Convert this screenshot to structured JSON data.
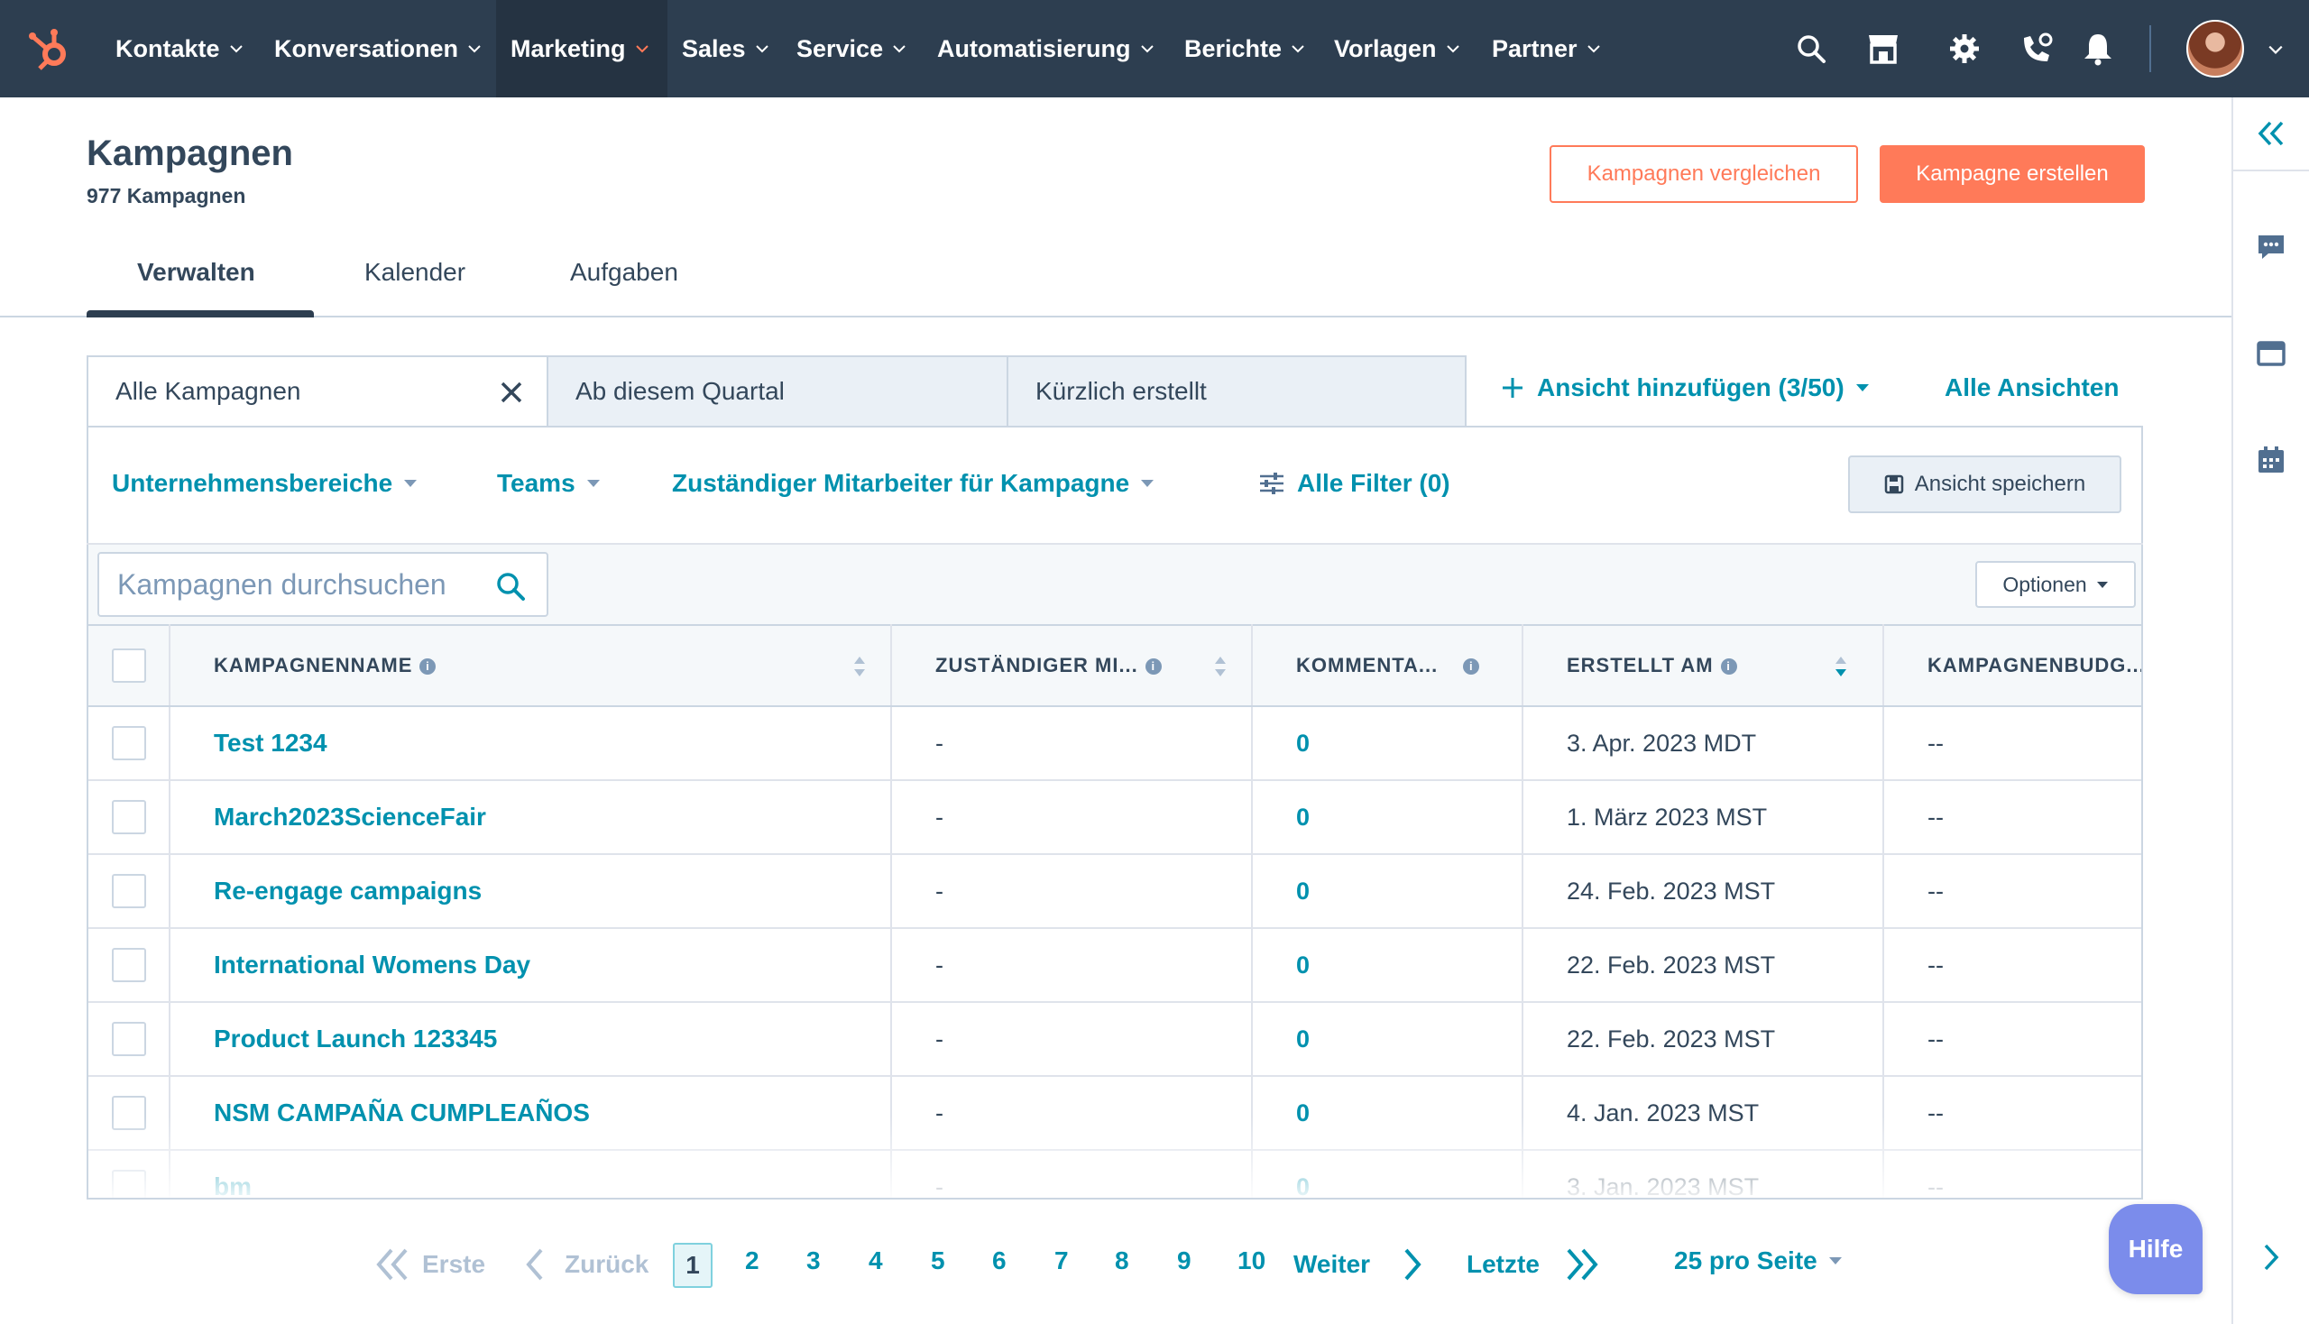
{
  "nav": {
    "items": [
      {
        "label": "Kontakte"
      },
      {
        "label": "Konversationen"
      },
      {
        "label": "Marketing"
      },
      {
        "label": "Sales"
      },
      {
        "label": "Service"
      },
      {
        "label": "Automatisierung"
      },
      {
        "label": "Berichte"
      },
      {
        "label": "Vorlagen"
      },
      {
        "label": "Partner"
      }
    ],
    "active": "Marketing",
    "icons": [
      "search-icon",
      "marketplace-icon",
      "settings-icon",
      "calling-icon",
      "notifications-icon"
    ]
  },
  "header": {
    "title": "Kampagnen",
    "subtitle": "977 Kampagnen",
    "compare_button": "Kampagnen vergleichen",
    "create_button": "Kampagne erstellen"
  },
  "tabs": [
    "Verwalten",
    "Kalender",
    "Aufgaben"
  ],
  "views": {
    "tabs": [
      "Alle Kampagnen",
      "Ab diesem Quartal",
      "Kürzlich erstellt"
    ],
    "add_view": "Ansicht hinzufügen (3/50)",
    "all_views": "Alle Ansichten"
  },
  "filters": {
    "business_units": "Unternehmensbereiche",
    "teams": "Teams",
    "owner": "Zuständiger Mitarbeiter für Kampagne",
    "all_filters": "Alle Filter (0)",
    "save_view": "Ansicht speichern"
  },
  "search": {
    "placeholder": "Kampagnen durchsuchen"
  },
  "options_button": "Optionen",
  "table": {
    "columns": [
      "KAMPAGNENNAME",
      "ZUSTÄNDIGER MI...",
      "KOMMENTA...",
      "ERSTELLT AM",
      "KAMPAGNENBUDG..."
    ],
    "rows": [
      {
        "name": "Test 1234",
        "owner": "-",
        "comments": "0",
        "created": "3. Apr. 2023 MDT",
        "budget": "--"
      },
      {
        "name": "March2023ScienceFair",
        "owner": "-",
        "comments": "0",
        "created": "1. März 2023 MST",
        "budget": "--"
      },
      {
        "name": "Re-engage campaigns",
        "owner": "-",
        "comments": "0",
        "created": "24. Feb. 2023 MST",
        "budget": "--"
      },
      {
        "name": "International Womens Day",
        "owner": "-",
        "comments": "0",
        "created": "22. Feb. 2023 MST",
        "budget": "--"
      },
      {
        "name": "Product Launch 123345",
        "owner": "-",
        "comments": "0",
        "created": "22. Feb. 2023 MST",
        "budget": "--"
      },
      {
        "name": "NSM CAMPAÑA CUMPLEAÑOS",
        "owner": "-",
        "comments": "0",
        "created": "4. Jan. 2023 MST",
        "budget": "--"
      },
      {
        "name": "bm",
        "owner": "-",
        "comments": "0",
        "created": "3. Jan. 2023 MST",
        "budget": "--"
      }
    ]
  },
  "pagination": {
    "first": "Erste",
    "prev": "Zurück",
    "current": "1",
    "pages": [
      "2",
      "3",
      "4",
      "5",
      "6",
      "7",
      "8",
      "9",
      "10"
    ],
    "next": "Weiter",
    "last": "Letzte",
    "per_page": "25 pro Seite"
  },
  "help_button": "Hilfe",
  "colors": {
    "nav_bg": "#2d3e50",
    "accent": "#ff7a59",
    "link": "#0091ae",
    "help": "#7b8ceb"
  }
}
